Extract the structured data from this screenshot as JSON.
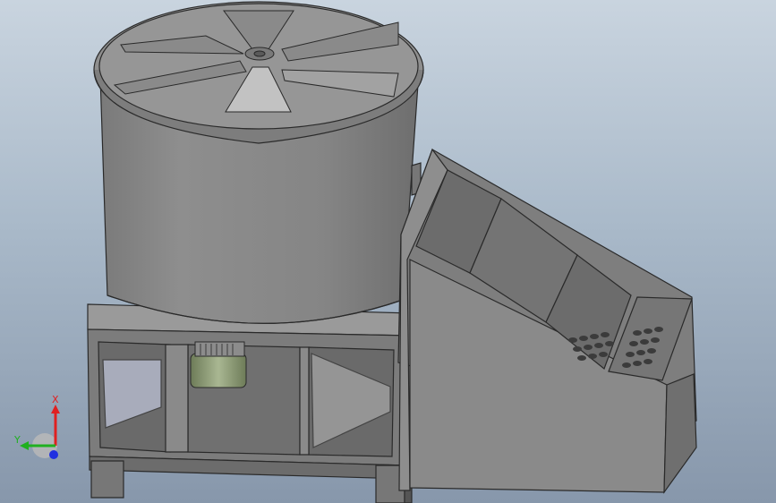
{
  "viewport": {
    "background_top": "#c9d4df",
    "background_bottom": "#8797ab",
    "model_color": "#8a8a8a",
    "motor_color": "#7f9068"
  },
  "triad": {
    "x_label": "X",
    "y_label": "Y",
    "x_color": "#e02020",
    "y_color": "#20b020",
    "z_color": "#2030e0"
  }
}
